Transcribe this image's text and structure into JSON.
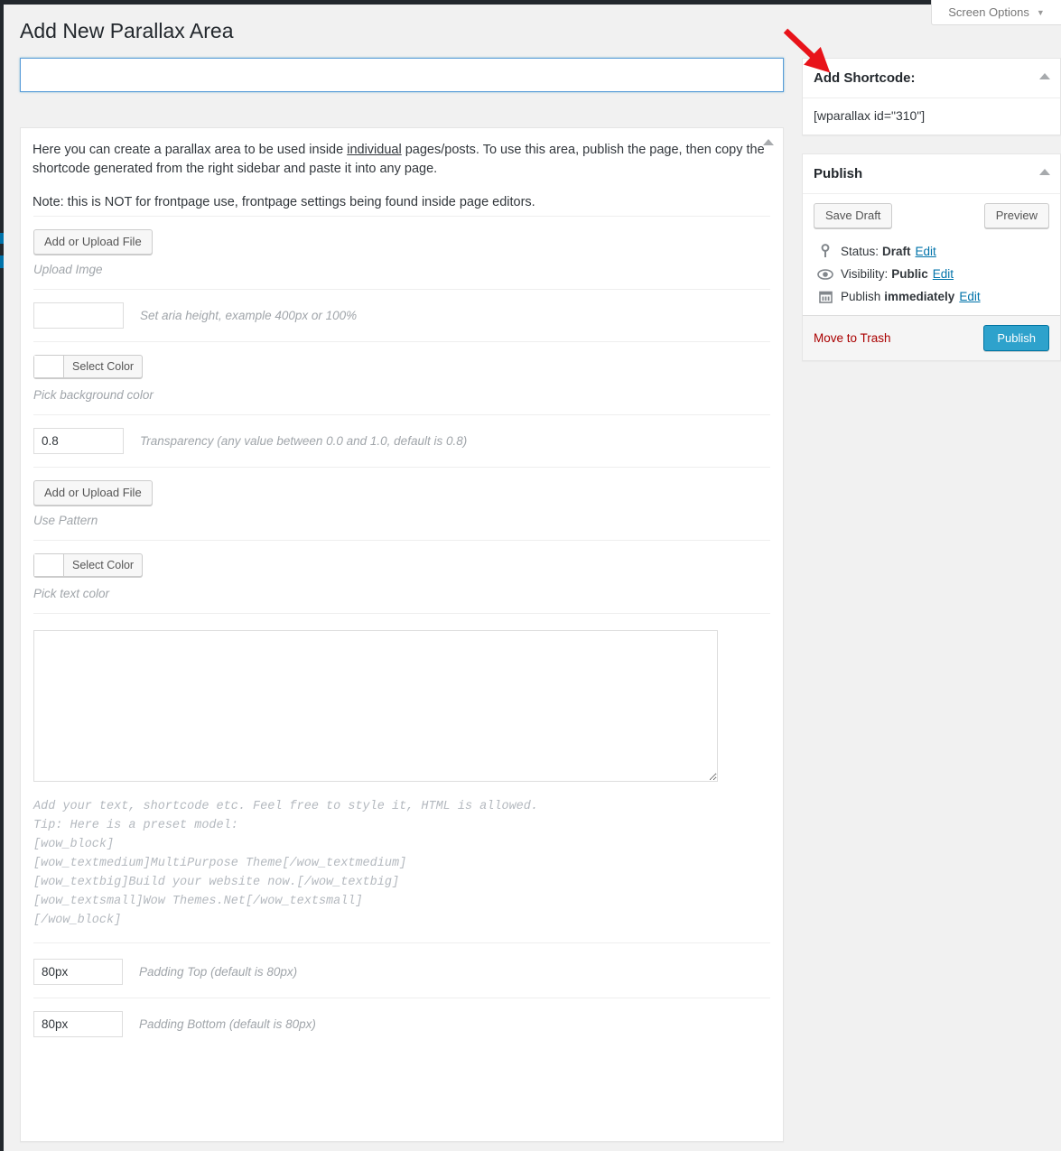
{
  "header": {
    "screen_options_label": "Screen Options",
    "screen_options_caret": "chevron-down-icon",
    "page_title": "Add New Parallax Area"
  },
  "title_field": {
    "value": "",
    "placeholder": ""
  },
  "main_panel": {
    "intro_paragraph_1_part1": "Here you can create a parallax area to be used inside ",
    "intro_emphasis": "individual",
    "intro_paragraph_1_part2": " pages/posts. To use this area, publish the page, then copy the shortcode generated from the right sidebar and paste it into any page.",
    "intro_paragraph_2": "Note: this is NOT for frontpage use, frontpage settings being found inside page editors.",
    "fields": {
      "upload_image": {
        "button_label": "Add or Upload File",
        "hint": "Upload Imge"
      },
      "area_height": {
        "value": "",
        "hint": "Set aria height, example 400px or 100%"
      },
      "background_color": {
        "button_label": "Select Color",
        "swatch_color": "#ffffff",
        "hint": "Pick background color"
      },
      "transparency": {
        "value": "0.8",
        "hint": "Transparency (any value between 0.0 and 1.0, default is 0.8)"
      },
      "pattern": {
        "button_label": "Add or Upload File",
        "hint": "Use Pattern"
      },
      "text_color": {
        "button_label": "Select Color",
        "swatch_color": "#ffffff",
        "hint": "Pick text color"
      },
      "content": {
        "value": "",
        "help_lines": [
          "Add your text, shortcode etc. Feel free to style it, HTML is allowed.",
          "Tip: Here is a preset model:",
          "[wow_block]",
          "[wow_textmedium]MultiPurpose Theme[/wow_textmedium]",
          "[wow_textbig]Build your website now.[/wow_textbig]",
          "[wow_textsmall]Wow Themes.Net[/wow_textsmall]",
          "[/wow_block]"
        ]
      },
      "padding_top": {
        "value": "80px",
        "hint": "Padding Top (default is 80px)"
      },
      "padding_bottom": {
        "value": "80px",
        "hint": "Padding Bottom (default is 80px)"
      }
    }
  },
  "sidebar": {
    "shortcode_box": {
      "title": "Add Shortcode:",
      "shortcode": "[wparallax id=\"310\"]",
      "toggle_icon": "chevron-up-icon"
    },
    "publish_box": {
      "title": "Publish",
      "toggle_icon": "chevron-up-icon",
      "save_draft_label": "Save Draft",
      "preview_label": "Preview",
      "status": {
        "icon": "pin-icon",
        "label": "Status:",
        "value": "Draft",
        "edit_label": "Edit"
      },
      "visibility": {
        "icon": "eye-icon",
        "label": "Visibility:",
        "value": "Public",
        "edit_label": "Edit"
      },
      "schedule": {
        "icon": "calendar-icon",
        "label": "Publish",
        "value": "immediately",
        "edit_label": "Edit"
      },
      "trash_label": "Move to Trash",
      "publish_label": "Publish"
    }
  },
  "annotation": {
    "arrow_color": "#e8131a",
    "points_to": "Add Shortcode:"
  },
  "colors": {
    "accent": "#2ea2cc",
    "link": "#0073aa",
    "danger": "#a00000",
    "admin_dark": "#23282d",
    "page_bg": "#f1f1f1",
    "focus_border": "#5b9dd9"
  }
}
